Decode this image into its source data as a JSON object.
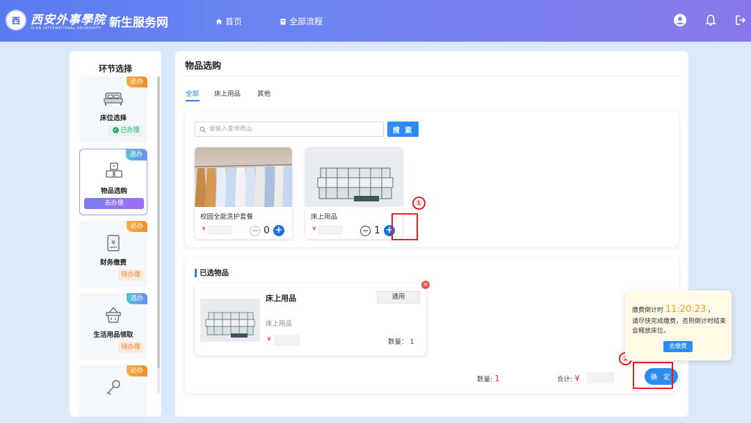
{
  "header": {
    "logo_char": "西",
    "school_name": "西安外事學院",
    "school_en": "XI'AN INTERNATIONAL UNIVERSITY",
    "site_title": "新生服务网",
    "nav": [
      {
        "label": "首页",
        "icon": "home-icon"
      },
      {
        "label": "全部流程",
        "icon": "document-icon"
      }
    ],
    "icons": [
      "user-avatar-icon",
      "bell-icon",
      "logout-icon"
    ]
  },
  "sidebar": {
    "title": "环节选择",
    "steps": [
      {
        "name": "床位选择",
        "tag": "必办",
        "status": "已办理",
        "icon": "bed-icon"
      },
      {
        "name": "物品选购",
        "tag": "选办",
        "status": "去办理",
        "icon": "boxes-icon"
      },
      {
        "name": "财务缴费",
        "tag": "必办",
        "status": "待办理",
        "icon": "payment-icon"
      },
      {
        "name": "生活用品领取",
        "tag": "选办",
        "status": "待办理",
        "icon": "basket-icon"
      },
      {
        "name": "",
        "tag": "必办",
        "status": "",
        "icon": "key-icon"
      }
    ]
  },
  "main": {
    "title": "物品选购",
    "tabs": [
      "全部",
      "床上用品",
      "其他"
    ],
    "active_tab": "全部",
    "search": {
      "placeholder": "请输入查询商品",
      "button": "搜 索"
    },
    "products": [
      {
        "name": "校园全能洗护套餐",
        "price_symbol": "¥",
        "qty": "0"
      },
      {
        "name": "床上用品",
        "price_symbol": "¥",
        "qty": "1"
      }
    ],
    "annotations": [
      "①",
      "②"
    ],
    "selected": {
      "title": "已选物品",
      "item": {
        "name": "床上用品",
        "tag": "通用",
        "desc": "床上用品",
        "price_symbol": "¥",
        "qty_label": "数量：",
        "qty": "1"
      }
    },
    "summary": {
      "qty_label": "数量:",
      "qty": "1",
      "total_label": "合计:",
      "total_symbol": "¥"
    },
    "confirm_label": "确 定"
  },
  "popup": {
    "prefix": "缴费倒计时",
    "time": "11:20:23",
    "suffix": "，",
    "message": "请尽快完成缴费，否则倒计时结束会释放床位。",
    "button": "去缴费"
  },
  "colors": {
    "accent": "#2d8cf0",
    "price": "#e23b3b",
    "annotation": "#e02020"
  }
}
